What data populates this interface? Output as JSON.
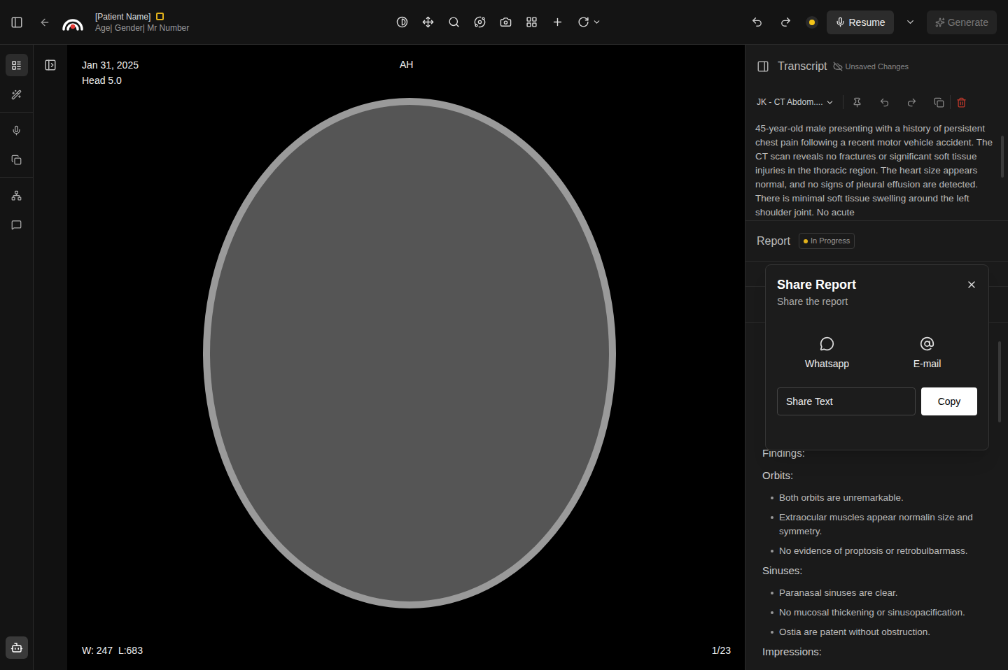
{
  "header": {
    "patient_name": "[Patient Name]",
    "patient_meta": "Age| Gender| Mr Number",
    "resume_button": "Resume",
    "generate_button": {
      "label": "Generate",
      "disabled": true
    }
  },
  "left_sidebar": {
    "items": [
      {
        "selected": true
      },
      {
        "selected": false
      },
      {
        "selected": false
      },
      {
        "selected": false
      },
      {
        "selected": false
      },
      {
        "selected": false
      }
    ]
  },
  "viewer": {
    "date": "Jan 31, 2025",
    "series": "Head 5.0",
    "orientation": "AH",
    "window_level": "W: 247  L:683",
    "slice": "1/23"
  },
  "transcript": {
    "title": "Transcript",
    "status": "Unsaved Changes",
    "template": "JK - CT Abdom....",
    "text": "45-year-old male presenting with a history of persistent chest pain following a recent motor vehicle accident. The CT scan reveals no fractures or significant soft tissue injuries in the thoracic region. The heart size appears normal, and no signs of pleural effusion are detected. There is minimal soft tissue swelling around the left shoulder joint. No acute"
  },
  "report": {
    "title": "Report",
    "status": "In Progress",
    "sections": [
      {
        "heading": "Findings:",
        "items": []
      },
      {
        "heading": "Orbits:",
        "items": [
          "Both orbits are unremarkable.",
          "Extraocular muscles appear normalin size and symmetry.",
          "No evidence of proptosis or retrobulbarmass."
        ]
      },
      {
        "heading": "Sinuses:",
        "items": [
          "Paranasal sinuses are clear.",
          "No mucosal thickening or sinusopacification.",
          "Ostia are patent without obstruction."
        ]
      },
      {
        "heading": "Impressions:",
        "items": []
      }
    ]
  },
  "share_dialog": {
    "title": "Share Report",
    "subtitle": "Share the report",
    "options": [
      "Whatsapp",
      "E-mail"
    ],
    "share_text_placeholder": "Share Text",
    "copy_button": "Copy"
  }
}
